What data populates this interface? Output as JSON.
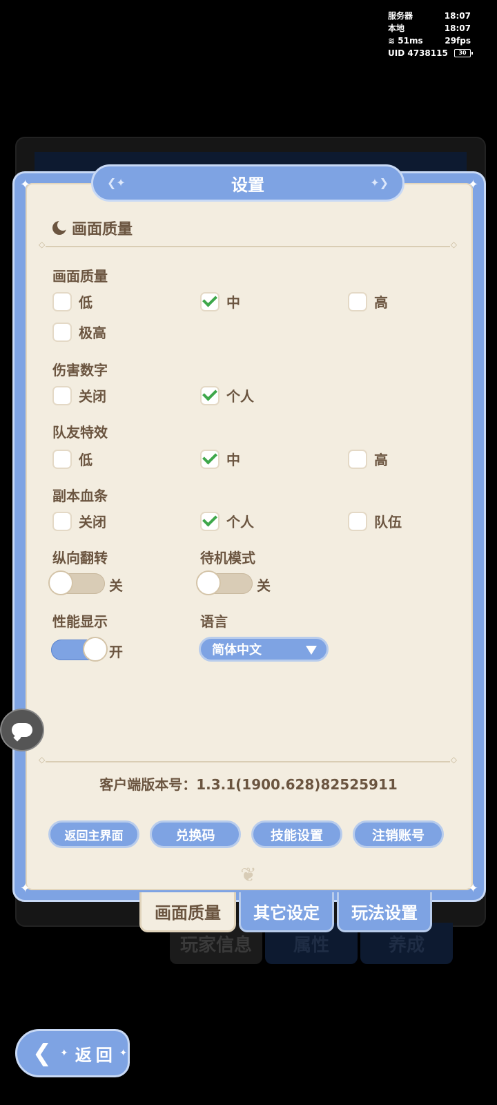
{
  "status": {
    "server_label": "服务器",
    "server_time": "18:07",
    "local_label": "本地",
    "local_time": "18:07",
    "ping": "51ms",
    "fps": "29fps",
    "uid": "UID 4738115",
    "battery": "30"
  },
  "background_tabs": [
    "玩家信息",
    "属性",
    "养成"
  ],
  "dialog": {
    "title": "设置",
    "section_title": "画面质量",
    "groups": {
      "quality": {
        "label": "画面质量",
        "options": [
          "低",
          "中",
          "高",
          "极高"
        ],
        "selected": "中"
      },
      "damage": {
        "label": "伤害数字",
        "options": [
          "关闭",
          "个人"
        ],
        "selected": "个人"
      },
      "team_fx": {
        "label": "队友特效",
        "options": [
          "低",
          "中",
          "高"
        ],
        "selected": "中"
      },
      "dungeon_hp": {
        "label": "副本血条",
        "options": [
          "关闭",
          "个人",
          "队伍"
        ],
        "selected": "个人"
      }
    },
    "toggles": {
      "flip": {
        "label": "纵向翻转",
        "state": "关"
      },
      "standby": {
        "label": "待机模式",
        "state": "关"
      },
      "perf": {
        "label": "性能显示",
        "state": "开"
      }
    },
    "language": {
      "label": "语言",
      "value": "简体中文"
    },
    "version": "客户端版本号：1.3.1(1900.628)82525911",
    "buttons": [
      "返回主界面",
      "兑换码",
      "技能设置",
      "注销账号"
    ]
  },
  "tabs": [
    "画面质量",
    "其它设定",
    "玩法设置"
  ],
  "active_tab": "画面质量",
  "back_label": "返回",
  "colors": {
    "accent": "#7ea3e3",
    "paper": "#f3ede0",
    "text": "#6b5540",
    "check": "#3ea74a"
  }
}
